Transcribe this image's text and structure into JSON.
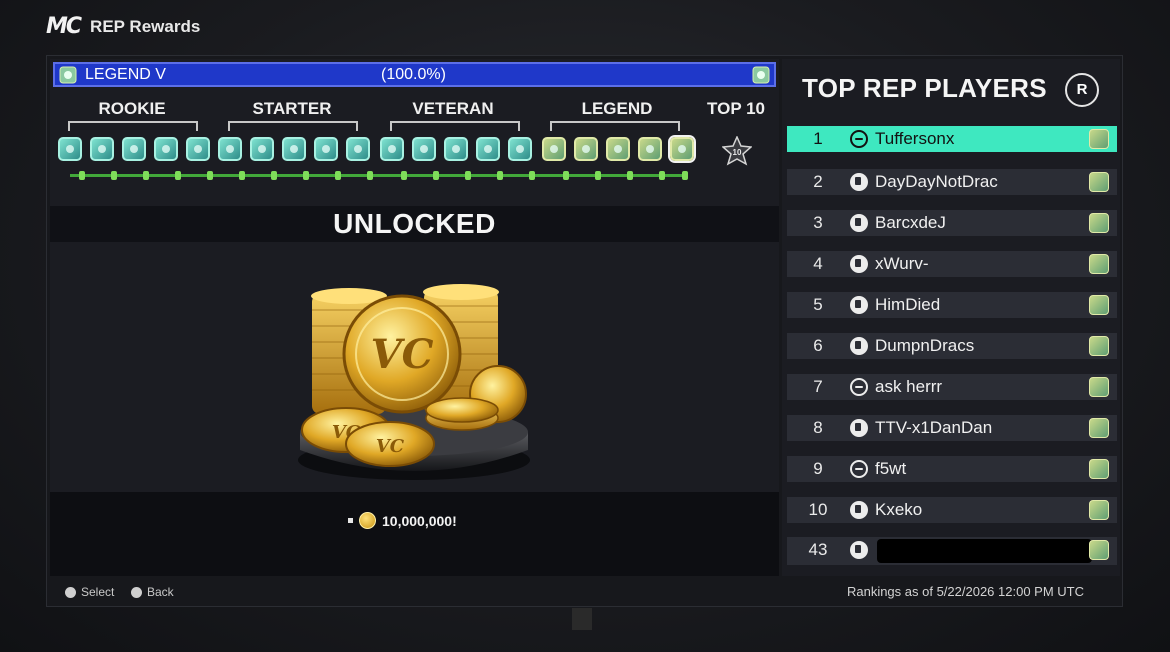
{
  "app": {
    "logo_text": "MC",
    "title": "REP Rewards"
  },
  "level": {
    "name": "LEGEND V",
    "percent": "(100.0%)"
  },
  "tiers": [
    "ROOKIE",
    "STARTER",
    "VETERAN",
    "LEGEND",
    "TOP 10"
  ],
  "reward": {
    "status": "UNLOCKED",
    "amount": "10,000,000!"
  },
  "leaderboard": {
    "title": "TOP REP PLAYERS",
    "r_button": "R",
    "players": [
      {
        "rank": "1",
        "name": "Tuffersonx",
        "platform": "xbox"
      },
      {
        "rank": "2",
        "name": "DayDayNotDrac",
        "platform": "playstation"
      },
      {
        "rank": "3",
        "name": "BarcxdeJ",
        "platform": "playstation"
      },
      {
        "rank": "4",
        "name": "xWurv-",
        "platform": "playstation"
      },
      {
        "rank": "5",
        "name": "HimDied",
        "platform": "playstation"
      },
      {
        "rank": "6",
        "name": "DumpnDracs",
        "platform": "playstation"
      },
      {
        "rank": "7",
        "name": "ask herrr",
        "platform": "xbox"
      },
      {
        "rank": "8",
        "name": "TTV-x1DanDan",
        "platform": "playstation"
      },
      {
        "rank": "9",
        "name": "f5wt",
        "platform": "xbox"
      },
      {
        "rank": "10",
        "name": "Kxeko",
        "platform": "playstation"
      }
    ],
    "self_rank": "43",
    "rankings_date": "Rankings as of 5/22/2026 12:00 PM UTC"
  },
  "hints": {
    "select": "Select",
    "back": "Back"
  },
  "colors": {
    "accent_teal": "#3ee8c0",
    "level_bar": "#1f38c9",
    "progress_green": "#42a83a"
  }
}
